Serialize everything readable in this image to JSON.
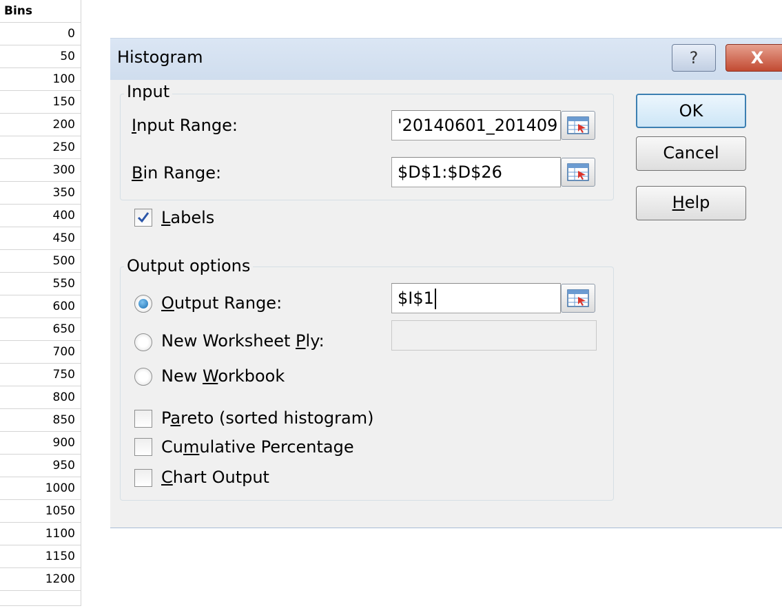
{
  "sheet": {
    "header": "Bins",
    "values": [
      "0",
      "50",
      "100",
      "150",
      "200",
      "250",
      "300",
      "350",
      "400",
      "450",
      "500",
      "550",
      "600",
      "650",
      "700",
      "750",
      "800",
      "850",
      "900",
      "950",
      "1000",
      "1050",
      "1100",
      "1150",
      "1200"
    ]
  },
  "dialog": {
    "title": "Histogram",
    "help_glyph": "?",
    "close_glyph": "X",
    "input_group": {
      "legend": "Input",
      "input_range_label": "Input Range:",
      "input_range_value": "'20140601_201409",
      "bin_range_label": "Bin Range:",
      "bin_range_value": "$D$1:$D$26"
    },
    "labels_checkbox": {
      "label": "Labels",
      "checked": true
    },
    "output_group": {
      "legend": "Output options",
      "output_range_label": "Output Range:",
      "output_range_value": "$I$1",
      "new_worksheet_label": "New Worksheet Ply:",
      "new_workbook_label": "New Workbook",
      "selected_option": "Output Range",
      "pareto_label": "Pareto (sorted histogram)",
      "cumulative_label": "Cumulative Percentage",
      "chart_output_label": "Chart Output"
    },
    "buttons": {
      "ok": "OK",
      "cancel": "Cancel",
      "help": "Help"
    }
  },
  "colors": {
    "titlebar": "#dbe6f4",
    "close_button": "#c24a32",
    "dialog_bg": "#f0f0f0"
  }
}
